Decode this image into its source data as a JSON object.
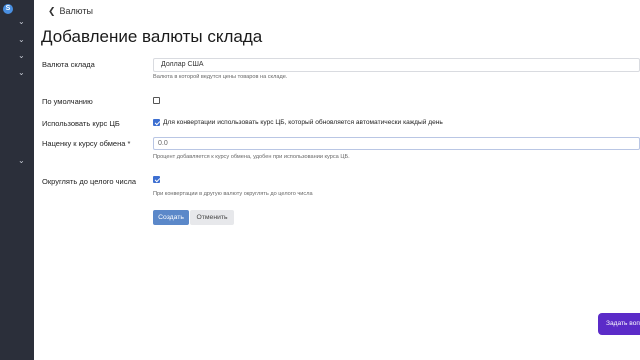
{
  "sidebar": {
    "logo": "S",
    "chevron_count": 5
  },
  "breadcrumb": {
    "back_label": "Валюты",
    "back_icon": "chevron-left-icon"
  },
  "page": {
    "title": "Добавление валюты склада"
  },
  "form": {
    "warehouse_currency": {
      "label": "Валюта склада",
      "value": "Доллар США",
      "hint": "Валюта в которой ведутся цены товаров на складе."
    },
    "default": {
      "label": "По умолчанию",
      "checked": false
    },
    "use_cb_rate": {
      "label": "Использовать курс ЦБ",
      "checked": true,
      "text": "Для конвертации использовать курс ЦБ, который обновляется автоматически каждый день"
    },
    "markup": {
      "label": "Наценку к курсу обмена *",
      "value": "0.0",
      "hint": "Процент добавляется к курсу обмена, удобен при использовании курса ЦБ."
    },
    "round": {
      "label": "Округлять до целого числа",
      "checked": true,
      "hint": "При конвертации в другую валюту округлять до целого числа"
    },
    "buttons": {
      "create": "Создать",
      "cancel": "Отменить"
    }
  },
  "floating_button": {
    "label": "Задать вопрос"
  },
  "colors": {
    "primary": "#5b88c9",
    "accent": "#5b2bc8",
    "checkbox": "#3d6fd1",
    "sidebar": "#2b2f3a"
  }
}
